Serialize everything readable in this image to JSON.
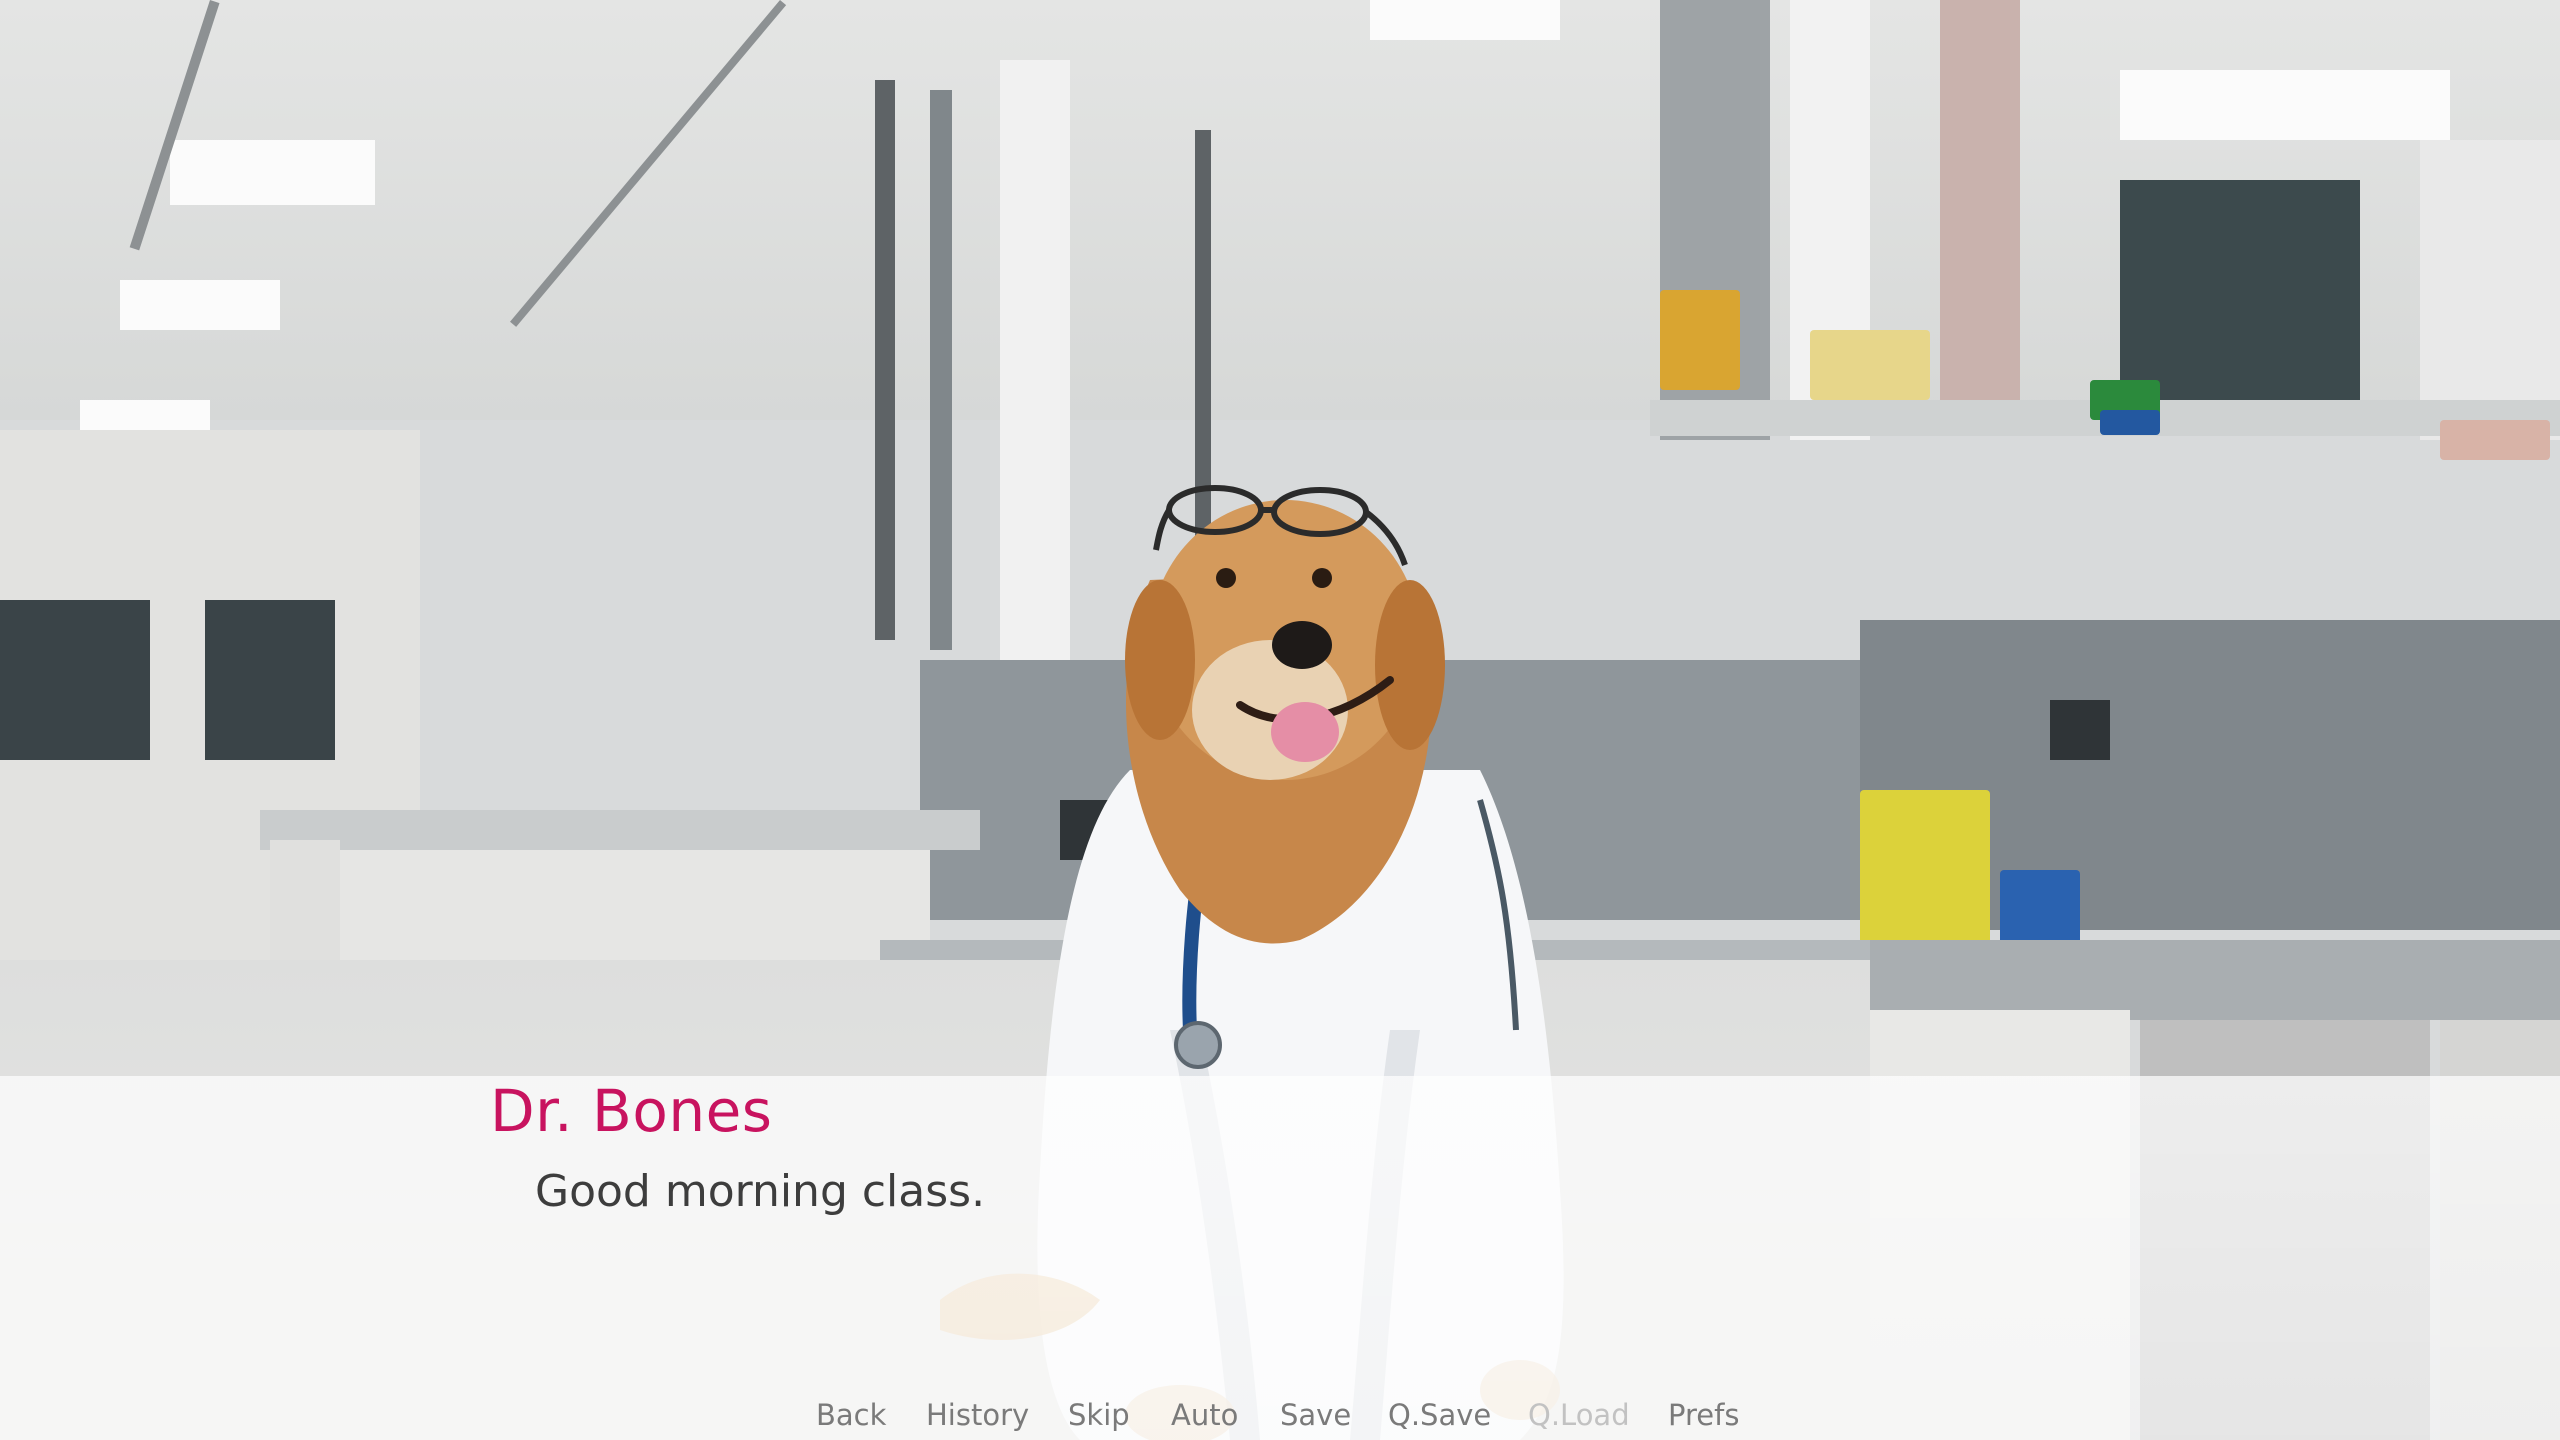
{
  "dialogue": {
    "speaker": "Dr. Bones",
    "text": "Good morning class."
  },
  "quick_menu": [
    {
      "label": "Back",
      "enabled": true
    },
    {
      "label": "History",
      "enabled": true
    },
    {
      "label": "Skip",
      "enabled": true
    },
    {
      "label": "Auto",
      "enabled": true
    },
    {
      "label": "Save",
      "enabled": true
    },
    {
      "label": "Q.Save",
      "enabled": true
    },
    {
      "label": "Q.Load",
      "enabled": false
    },
    {
      "label": "Prefs",
      "enabled": true
    }
  ],
  "colors": {
    "speaker_name": "#c8135f",
    "dialogue_text": "#3d3d3d",
    "menu_enabled": "#7a7a7a",
    "menu_disabled": "#c2c2c2"
  }
}
